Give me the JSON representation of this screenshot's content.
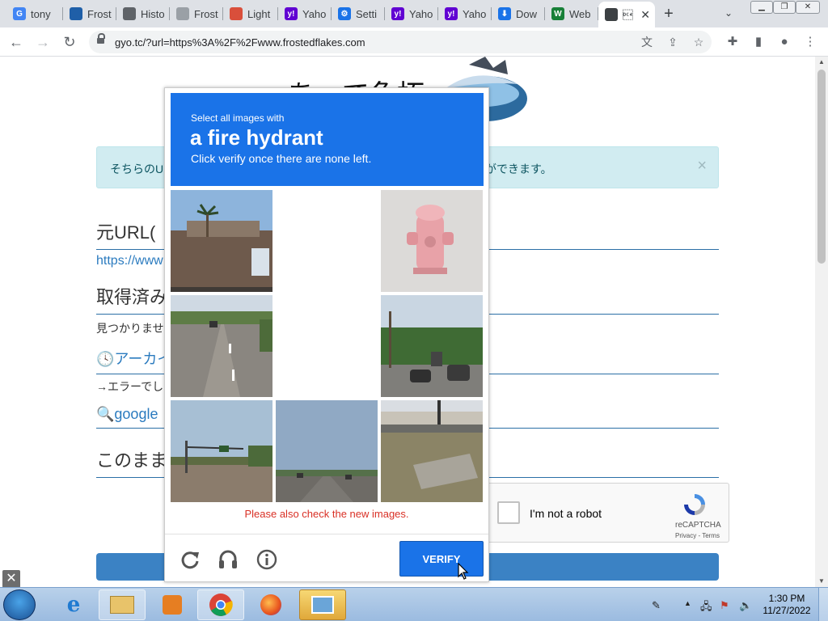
{
  "tabs": [
    {
      "label": "tony",
      "icon": "google-icon",
      "color": "#4285f4",
      "glyph": "G"
    },
    {
      "label": "Frost",
      "icon": "frosted-flakes-icon",
      "color": "#1f5fa8",
      "glyph": ""
    },
    {
      "label": "Histo",
      "icon": "globe-icon",
      "color": "#5f6368",
      "glyph": ""
    },
    {
      "label": "Frost",
      "icon": "shirt-icon",
      "color": "#9aa0a6",
      "glyph": ""
    },
    {
      "label": "Light",
      "icon": "bulb-icon",
      "color": "#d94f3b",
      "glyph": ""
    },
    {
      "label": "Yaho",
      "icon": "yahoo-icon",
      "color": "#6001d2",
      "glyph": "y!"
    },
    {
      "label": "Setti",
      "icon": "gear-icon",
      "color": "#1a73e8",
      "glyph": "⚙"
    },
    {
      "label": "Yaho",
      "icon": "yahoo-icon",
      "color": "#6001d2",
      "glyph": "y!"
    },
    {
      "label": "Yaho",
      "icon": "yahoo-icon",
      "color": "#6001d2",
      "glyph": "y!"
    },
    {
      "label": "Dow",
      "icon": "download-icon",
      "color": "#1a73e8",
      "glyph": "⬇"
    },
    {
      "label": "Web",
      "icon": "web-icon",
      "color": "#188038",
      "glyph": "W"
    },
    {
      "label": "\u0014",
      "icon": "bird-icon",
      "color": "#3c4043",
      "glyph": ""
    }
  ],
  "active_tab_label": "",
  "address_bar": {
    "url": "gyo.tc/?url=https%3A%2F%2Fwww.frostedflakes.com"
  },
  "page": {
    "logo_text": "あ　で魚拓",
    "alert_left": "そちらのU",
    "alert_right": "ができます。",
    "heading1": "元URL(",
    "url_link": "https://www",
    "heading2": "取得済み",
    "not_found": "見つかりませ",
    "archive_link": "🕓アーカイ",
    "error_text": "→エラーでし",
    "google_link": "🔍google",
    "heading3": "このまま"
  },
  "recaptcha": {
    "label": "I'm not a robot",
    "brand": "reCAPTCHA",
    "terms": "Privacy - Terms"
  },
  "challenge": {
    "instruction": "Select all images with",
    "target": "a fire hydrant",
    "subtext": "Click verify once there are none left.",
    "error": "Please also check the new images.",
    "verify_label": "VERIFY",
    "colors": {
      "header": "#1a73e8",
      "error": "#d93025"
    }
  },
  "taskbar": {
    "time": "1:30 PM",
    "date": "11/27/2022"
  }
}
